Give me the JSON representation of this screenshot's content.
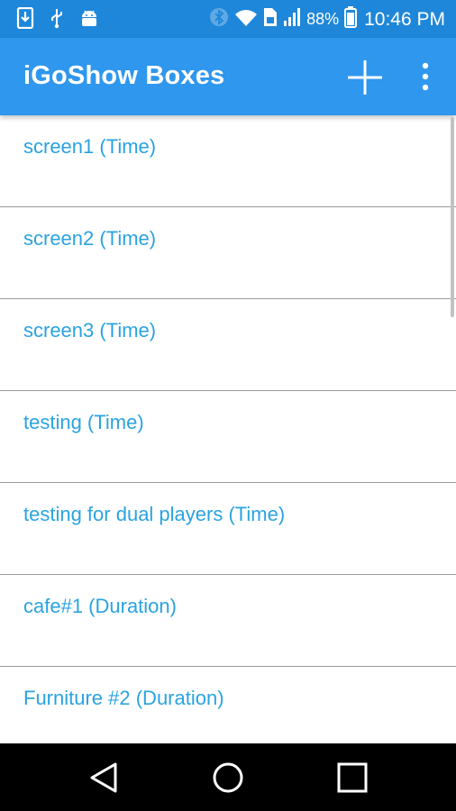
{
  "status_bar": {
    "battery_percent": "88%",
    "time": "10:46 PM",
    "icons": [
      "download-icon",
      "usb-icon",
      "android-icon",
      "bluetooth-icon",
      "wifi-icon",
      "sim-icon",
      "signal-icon",
      "battery-icon"
    ]
  },
  "app_bar": {
    "title": "iGoShow Boxes",
    "icons": [
      "add-icon",
      "more-vert-icon"
    ]
  },
  "list": {
    "items": [
      {
        "label": "screen1 (Time)"
      },
      {
        "label": "screen2 (Time)"
      },
      {
        "label": "screen3 (Time)"
      },
      {
        "label": "testing (Time)"
      },
      {
        "label": "testing for dual players (Time)"
      },
      {
        "label": "cafe#1 (Duration)"
      },
      {
        "label": "Furniture #2 (Duration)"
      }
    ]
  },
  "nav_bar": {
    "icons": [
      "back-icon",
      "home-icon",
      "recents-icon"
    ]
  },
  "colors": {
    "status_bar": "#1f87d9",
    "app_bar": "#2f97ee",
    "item_text": "#2aa3e0",
    "divider": "#9a9a9a"
  }
}
